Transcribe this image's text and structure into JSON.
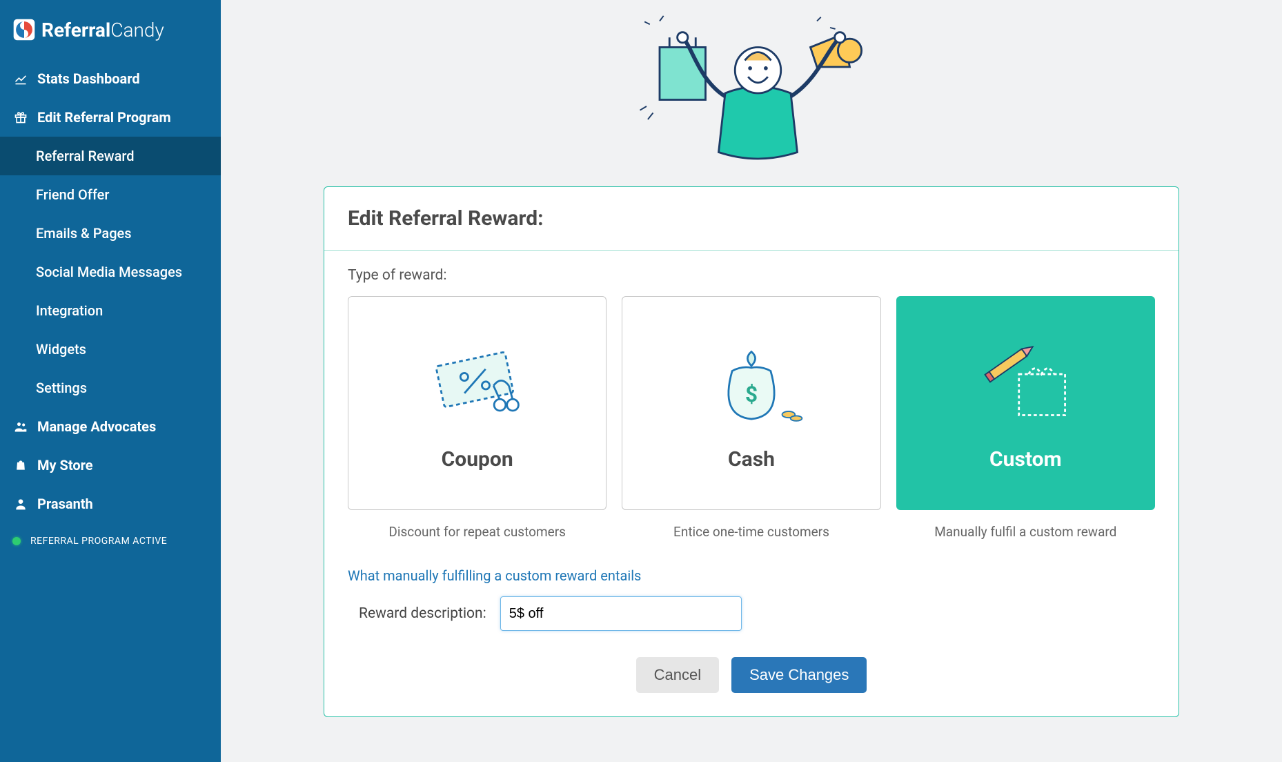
{
  "brand": {
    "name_bold": "Referral",
    "name_light": "Candy"
  },
  "sidebar": {
    "items": [
      {
        "label": "Stats Dashboard",
        "icon": "chart"
      },
      {
        "label": "Edit Referral Program",
        "icon": "gift"
      },
      {
        "label": "Manage Advocates",
        "icon": "people"
      },
      {
        "label": "My Store",
        "icon": "bag"
      },
      {
        "label": "Prasanth",
        "icon": "user"
      }
    ],
    "sub_items": [
      {
        "label": "Referral Reward"
      },
      {
        "label": "Friend Offer"
      },
      {
        "label": "Emails & Pages"
      },
      {
        "label": "Social Media Messages"
      },
      {
        "label": "Integration"
      },
      {
        "label": "Widgets"
      },
      {
        "label": "Settings"
      }
    ],
    "status_label": "REFERRAL PROGRAM ACTIVE"
  },
  "page": {
    "title": "Edit Referral Reward:",
    "type_label": "Type of reward:",
    "options": [
      {
        "title": "Coupon",
        "desc": "Discount for repeat customers"
      },
      {
        "title": "Cash",
        "desc": "Entice one-time customers"
      },
      {
        "title": "Custom",
        "desc": "Manually fulfil a custom reward"
      }
    ],
    "info_link": "What manually fulfilling a custom reward entails",
    "reward_desc_label": "Reward description:",
    "reward_desc_value": "5$ off",
    "cancel_label": "Cancel",
    "save_label": "Save Changes"
  },
  "colors": {
    "sidebar_bg": "#0f6699",
    "accent": "#22c3a6",
    "primary_button": "#2a77b8"
  }
}
